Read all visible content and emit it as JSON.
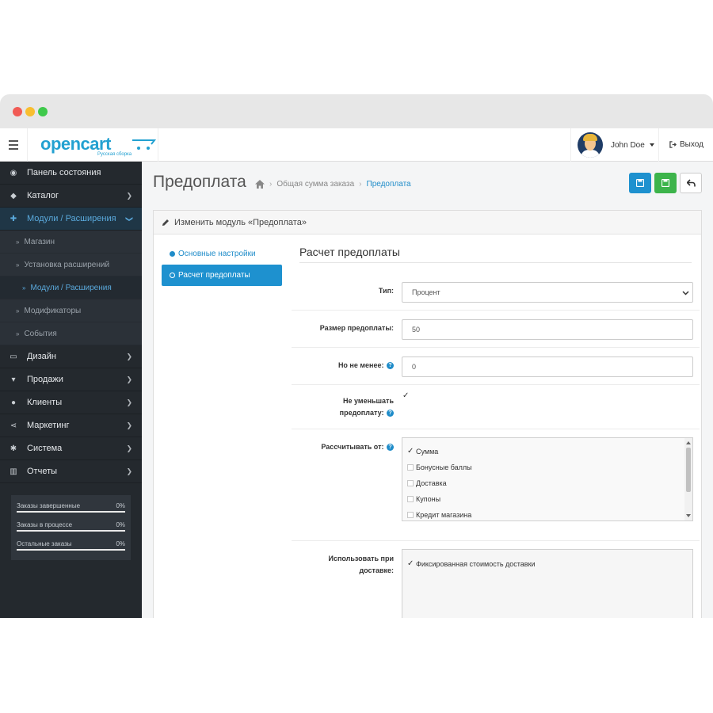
{
  "header": {
    "logo_text": "opencart",
    "logo_subtitle": "Русская сборка",
    "user_name": "John Doe",
    "logout_label": "Выход"
  },
  "sidebar": {
    "items": [
      {
        "label": "Панель состояния",
        "icon": "dashboard-icon"
      },
      {
        "label": "Каталог",
        "icon": "tag-icon"
      },
      {
        "label": "Модули / Расширения",
        "icon": "puzzle-icon"
      },
      {
        "label": "Дизайн",
        "icon": "monitor-icon"
      },
      {
        "label": "Продажи",
        "icon": "cart-icon"
      },
      {
        "label": "Клиенты",
        "icon": "user-icon"
      },
      {
        "label": "Маркетинг",
        "icon": "share-icon"
      },
      {
        "label": "Система",
        "icon": "gear-icon"
      },
      {
        "label": "Отчеты",
        "icon": "bar-chart-icon"
      }
    ],
    "sub_items": [
      "Магазин",
      "Установка расширений",
      "Модули / Расширения",
      "Модификаторы",
      "События"
    ],
    "stats": [
      {
        "label": "Заказы завершенные",
        "value": "0%",
        "progress": 0
      },
      {
        "label": "Заказы в процессе",
        "value": "0%",
        "progress": 0
      },
      {
        "label": "Остальные заказы",
        "value": "0%",
        "progress": 0
      }
    ]
  },
  "page": {
    "title": "Предоплата",
    "breadcrumb": [
      "Общая сумма заказа",
      "Предоплата"
    ]
  },
  "panel": {
    "heading": "Изменить модуль «Предоплата»",
    "tabs": [
      "Основные настройки",
      "Расчет предоплаты"
    ]
  },
  "form": {
    "section_title": "Расчет предоплаты",
    "type_label": "Тип:",
    "type_value": "Процент",
    "size_label": "Размер предоплаты:",
    "size_value": "50",
    "min_label": "Но не менее:",
    "min_value": "0",
    "no_reduce_label_1": "Не уменьшать",
    "no_reduce_label_2": "предоплату:",
    "no_reduce_checked": true,
    "calc_from_label": "Рассчитывать от:",
    "calc_from_options": [
      {
        "label": "Сумма",
        "checked": true
      },
      {
        "label": "Бонусные баллы",
        "checked": false
      },
      {
        "label": "Доставка",
        "checked": false
      },
      {
        "label": "Купоны",
        "checked": false
      },
      {
        "label": "Кредит магазина",
        "checked": false
      }
    ],
    "delivery_label_1": "Использовать при",
    "delivery_label_2": "доставке:",
    "delivery_options": [
      {
        "label": "Фиксированная стоимость доставки",
        "checked": true
      }
    ]
  },
  "colors": {
    "accent": "#1e91cf",
    "save_green": "#3db44b",
    "sidebar_bg": "#24292e"
  }
}
